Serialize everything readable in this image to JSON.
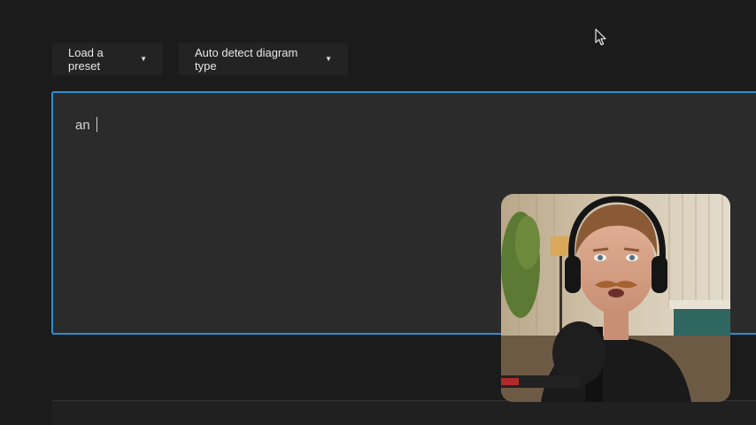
{
  "toolbar": {
    "preset_label": "Load a preset",
    "diagram_type_label": "Auto detect diagram type",
    "caret_icon": "caret-down-icon"
  },
  "editor": {
    "text": "an "
  },
  "overlay": {
    "cursor_icon": "mouse-pointer-icon",
    "webcam": "presenter-webcam-video"
  },
  "colors": {
    "background": "#1b1b1c",
    "editor_background": "#2b2b2c",
    "editor_focus_border": "#2a8fd0",
    "button_background": "#232324",
    "text": "#e7e7e7"
  }
}
